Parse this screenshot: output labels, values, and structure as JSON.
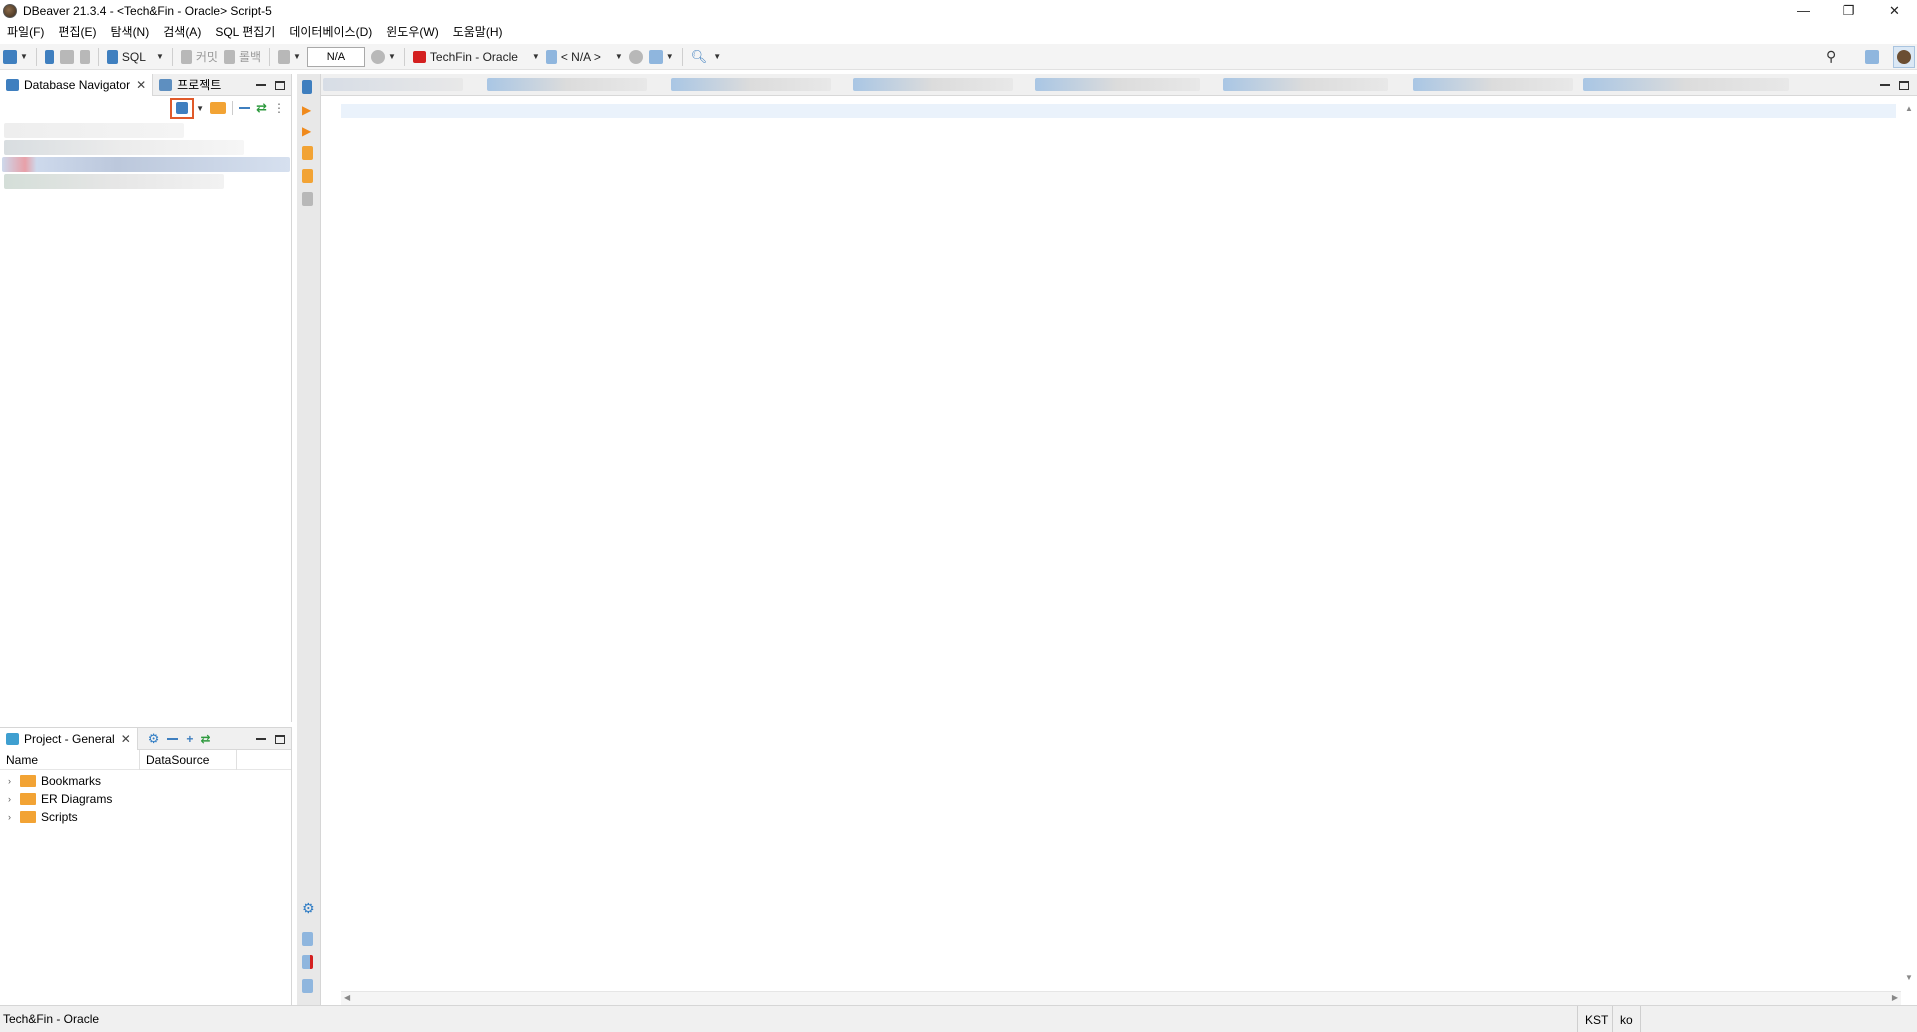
{
  "window": {
    "title": "DBeaver 21.3.4 - <Tech&Fin - Oracle> Script-5",
    "controls": {
      "minimize": "—",
      "maximize": "❐",
      "close": "✕"
    }
  },
  "menu": [
    "파일(F)",
    "편집(E)",
    "탐색(N)",
    "검색(A)",
    "SQL 편집기",
    "데이터베이스(D)",
    "윈도우(W)",
    "도움말(H)"
  ],
  "toolbar": {
    "sql_label": "SQL",
    "commit_label": "커밋",
    "rollback_label": "롤백",
    "transaction_value": "N/A",
    "connection_label": "TechFin - Oracle",
    "schema_label": "< N/A >"
  },
  "navigator": {
    "tab_active": "Database Navigator",
    "tab_projects": "프로젝트"
  },
  "project_panel": {
    "tab_label": "Project - General",
    "columns": [
      "Name",
      "DataSource"
    ],
    "items": [
      "Bookmarks",
      "ER Diagrams",
      "Scripts"
    ]
  },
  "status": {
    "connection": "Tech&Fin - Oracle",
    "timezone": "KST",
    "locale": "ko"
  },
  "colors": {
    "accent": "#3f7fbf",
    "highlight_border": "#e05a2a",
    "folder": "#f2a334",
    "oracle_red": "#d42020"
  }
}
